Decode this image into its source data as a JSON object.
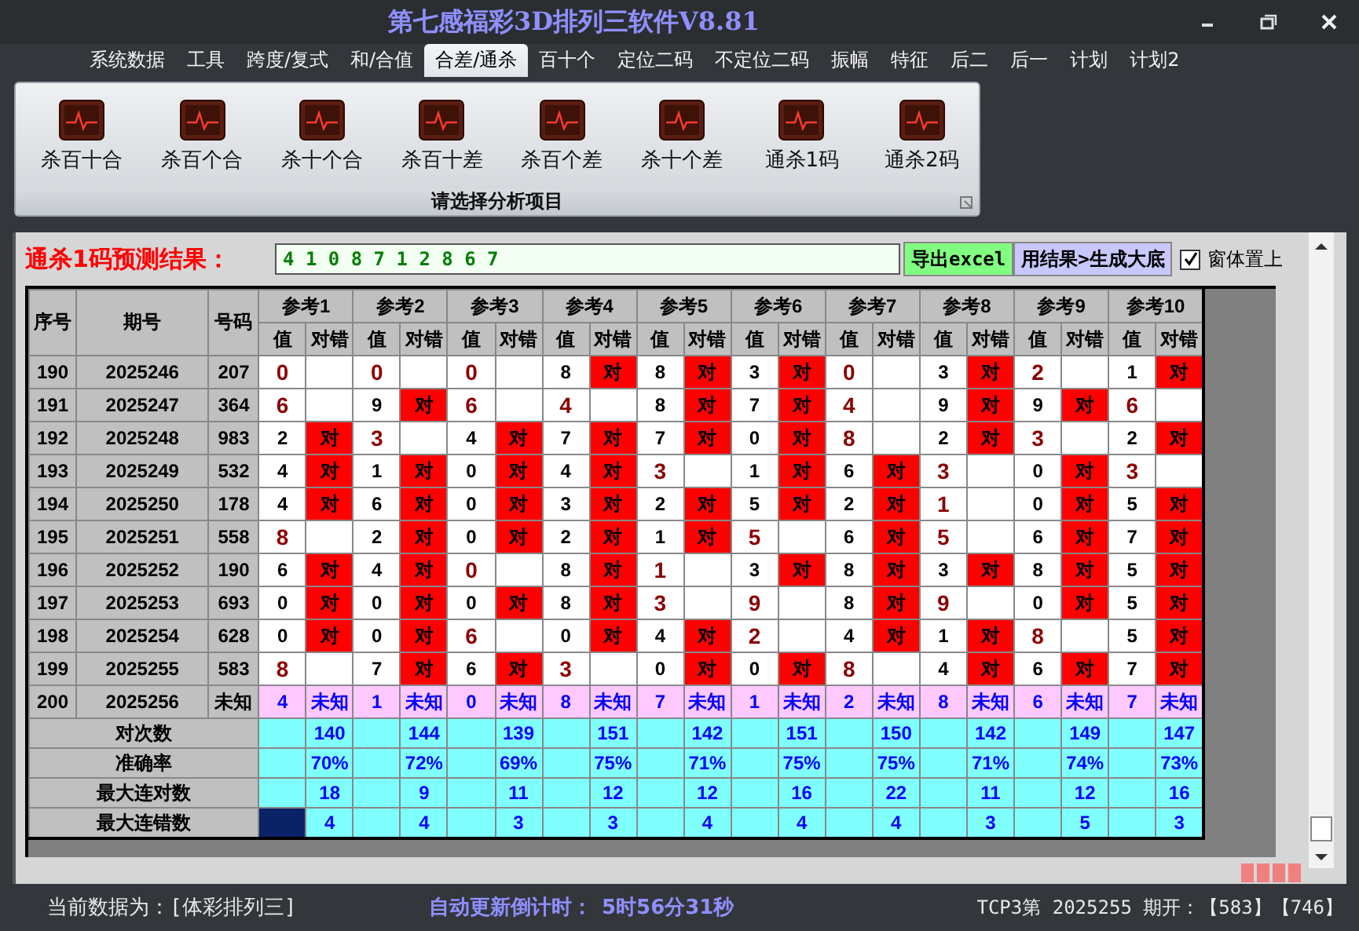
{
  "window": {
    "title": "第七感福彩3D排列三软件V8.81"
  },
  "menu": [
    {
      "label": "系统数据",
      "selected": false
    },
    {
      "label": "工具",
      "selected": false
    },
    {
      "label": "跨度/复式",
      "selected": false
    },
    {
      "label": "和/合值",
      "selected": false
    },
    {
      "label": "合差/通杀",
      "selected": true
    },
    {
      "label": "百十个",
      "selected": false
    },
    {
      "label": "定位二码",
      "selected": false
    },
    {
      "label": "不定位二码",
      "selected": false
    },
    {
      "label": "振幅",
      "selected": false
    },
    {
      "label": "特征",
      "selected": false
    },
    {
      "label": "后二",
      "selected": false
    },
    {
      "label": "后一",
      "selected": false
    },
    {
      "label": "计划",
      "selected": false
    },
    {
      "label": "计划2",
      "selected": false
    }
  ],
  "ribbon": {
    "items": [
      "杀百十合",
      "杀百个合",
      "杀十个合",
      "杀百十差",
      "杀百个差",
      "杀十个差",
      "通杀1码",
      "通杀2码"
    ],
    "caption": "请选择分析项目"
  },
  "prediction": {
    "label": "通杀1码预测结果：",
    "value": "4 1 0 8 7 1 2 8 6 7"
  },
  "buttons": [
    {
      "label": "导出excel",
      "kind": "export"
    },
    {
      "label": "用结果>生成大底",
      "kind": "generate"
    }
  ],
  "always_on_top": {
    "label": "窗体置上",
    "checked": true
  },
  "table": {
    "columns": [
      "序号",
      "期号",
      "号码"
    ],
    "groups": [
      {
        "label": "参考1",
        "subcolumns": [
          "值",
          "对错"
        ]
      },
      {
        "label": "参考2",
        "subcolumns": [
          "值",
          "对错"
        ]
      },
      {
        "label": "参考3",
        "subcolumns": [
          "值",
          "对错"
        ]
      },
      {
        "label": "参考4",
        "subcolumns": [
          "值",
          "对错"
        ]
      },
      {
        "label": "参考5",
        "subcolumns": [
          "值",
          "对错"
        ]
      },
      {
        "label": "参考6",
        "subcolumns": [
          "值",
          "对错"
        ]
      },
      {
        "label": "参考7",
        "subcolumns": [
          "值",
          "对错"
        ]
      },
      {
        "label": "参考8",
        "subcolumns": [
          "值",
          "对错"
        ]
      },
      {
        "label": "参考9",
        "subcolumns": [
          "值",
          "对错"
        ]
      },
      {
        "label": "参考10",
        "subcolumns": [
          "值",
          "对错"
        ]
      }
    ],
    "rows": [
      {
        "kind": "history",
        "seq": "190",
        "period": "2025246",
        "number": "207",
        "cells": [
          {
            "value": "0"
          },
          {
            "value": "0"
          },
          {
            "value": "0"
          },
          {
            "value": "8",
            "result": "对"
          },
          {
            "value": "8",
            "result": "对"
          },
          {
            "value": "3",
            "result": "对"
          },
          {
            "value": "0"
          },
          {
            "value": "3",
            "result": "对"
          },
          {
            "value": "2"
          },
          {
            "value": "1",
            "result": "对"
          }
        ]
      },
      {
        "kind": "history",
        "seq": "191",
        "period": "2025247",
        "number": "364",
        "cells": [
          {
            "value": "6"
          },
          {
            "value": "9",
            "result": "对"
          },
          {
            "value": "6"
          },
          {
            "value": "4"
          },
          {
            "value": "8",
            "result": "对"
          },
          {
            "value": "7",
            "result": "对"
          },
          {
            "value": "4"
          },
          {
            "value": "9",
            "result": "对"
          },
          {
            "value": "9",
            "result": "对"
          },
          {
            "value": "6"
          }
        ]
      },
      {
        "kind": "history",
        "seq": "192",
        "period": "2025248",
        "number": "983",
        "cells": [
          {
            "value": "2",
            "result": "对"
          },
          {
            "value": "3"
          },
          {
            "value": "4",
            "result": "对"
          },
          {
            "value": "7",
            "result": "对"
          },
          {
            "value": "7",
            "result": "对"
          },
          {
            "value": "0",
            "result": "对"
          },
          {
            "value": "8"
          },
          {
            "value": "2",
            "result": "对"
          },
          {
            "value": "3"
          },
          {
            "value": "2",
            "result": "对"
          }
        ]
      },
      {
        "kind": "history",
        "seq": "193",
        "period": "2025249",
        "number": "532",
        "cells": [
          {
            "value": "4",
            "result": "对"
          },
          {
            "value": "1",
            "result": "对"
          },
          {
            "value": "0",
            "result": "对"
          },
          {
            "value": "4",
            "result": "对"
          },
          {
            "value": "3"
          },
          {
            "value": "1",
            "result": "对"
          },
          {
            "value": "6",
            "result": "对"
          },
          {
            "value": "3"
          },
          {
            "value": "0",
            "result": "对"
          },
          {
            "value": "3"
          }
        ]
      },
      {
        "kind": "history",
        "seq": "194",
        "period": "2025250",
        "number": "178",
        "cells": [
          {
            "value": "4",
            "result": "对"
          },
          {
            "value": "6",
            "result": "对"
          },
          {
            "value": "0",
            "result": "对"
          },
          {
            "value": "3",
            "result": "对"
          },
          {
            "value": "2",
            "result": "对"
          },
          {
            "value": "5",
            "result": "对"
          },
          {
            "value": "2",
            "result": "对"
          },
          {
            "value": "1"
          },
          {
            "value": "0",
            "result": "对"
          },
          {
            "value": "5",
            "result": "对"
          }
        ]
      },
      {
        "kind": "history",
        "seq": "195",
        "period": "2025251",
        "number": "558",
        "cells": [
          {
            "value": "8"
          },
          {
            "value": "2",
            "result": "对"
          },
          {
            "value": "0",
            "result": "对"
          },
          {
            "value": "2",
            "result": "对"
          },
          {
            "value": "1",
            "result": "对"
          },
          {
            "value": "5"
          },
          {
            "value": "6",
            "result": "对"
          },
          {
            "value": "5"
          },
          {
            "value": "6",
            "result": "对"
          },
          {
            "value": "7",
            "result": "对"
          }
        ]
      },
      {
        "kind": "history",
        "seq": "196",
        "period": "2025252",
        "number": "190",
        "cells": [
          {
            "value": "6",
            "result": "对"
          },
          {
            "value": "4",
            "result": "对"
          },
          {
            "value": "0"
          },
          {
            "value": "8",
            "result": "对"
          },
          {
            "value": "1"
          },
          {
            "value": "3",
            "result": "对"
          },
          {
            "value": "8",
            "result": "对"
          },
          {
            "value": "3",
            "result": "对"
          },
          {
            "value": "8",
            "result": "对"
          },
          {
            "value": "5",
            "result": "对"
          }
        ]
      },
      {
        "kind": "history",
        "seq": "197",
        "period": "2025253",
        "number": "693",
        "cells": [
          {
            "value": "0",
            "result": "对"
          },
          {
            "value": "0",
            "result": "对"
          },
          {
            "value": "0",
            "result": "对"
          },
          {
            "value": "8",
            "result": "对"
          },
          {
            "value": "3"
          },
          {
            "value": "9"
          },
          {
            "value": "8",
            "result": "对"
          },
          {
            "value": "9"
          },
          {
            "value": "0",
            "result": "对"
          },
          {
            "value": "5",
            "result": "对"
          }
        ]
      },
      {
        "kind": "history",
        "seq": "198",
        "period": "2025254",
        "number": "628",
        "cells": [
          {
            "value": "0",
            "result": "对"
          },
          {
            "value": "0",
            "result": "对"
          },
          {
            "value": "6"
          },
          {
            "value": "0",
            "result": "对"
          },
          {
            "value": "4",
            "result": "对"
          },
          {
            "value": "2"
          },
          {
            "value": "4",
            "result": "对"
          },
          {
            "value": "1",
            "result": "对"
          },
          {
            "value": "8"
          },
          {
            "value": "5",
            "result": "对"
          }
        ]
      },
      {
        "kind": "history",
        "seq": "199",
        "period": "2025255",
        "number": "583",
        "cells": [
          {
            "value": "8"
          },
          {
            "value": "7",
            "result": "对"
          },
          {
            "value": "6",
            "result": "对"
          },
          {
            "value": "3"
          },
          {
            "value": "0",
            "result": "对"
          },
          {
            "value": "0",
            "result": "对"
          },
          {
            "value": "8"
          },
          {
            "value": "4",
            "result": "对"
          },
          {
            "value": "6",
            "result": "对"
          },
          {
            "value": "7",
            "result": "对"
          }
        ]
      },
      {
        "kind": "pending",
        "seq": "200",
        "period": "2025256",
        "number": "未知",
        "cells": [
          {
            "value": "4",
            "result": "未知"
          },
          {
            "value": "1",
            "result": "未知"
          },
          {
            "value": "0",
            "result": "未知"
          },
          {
            "value": "8",
            "result": "未知"
          },
          {
            "value": "7",
            "result": "未知"
          },
          {
            "value": "1",
            "result": "未知"
          },
          {
            "value": "2",
            "result": "未知"
          },
          {
            "value": "8",
            "result": "未知"
          },
          {
            "value": "6",
            "result": "未知"
          },
          {
            "value": "7",
            "result": "未知"
          }
        ]
      }
    ],
    "stats": [
      {
        "label": "对次数",
        "selected": false,
        "values": [
          "140",
          "144",
          "139",
          "151",
          "142",
          "151",
          "150",
          "142",
          "149",
          "147"
        ]
      },
      {
        "label": "准确率",
        "selected": false,
        "values": [
          "70%",
          "72%",
          "69%",
          "75%",
          "71%",
          "75%",
          "75%",
          "71%",
          "74%",
          "73%"
        ]
      },
      {
        "label": "最大连对数",
        "selected": false,
        "values": [
          "18",
          "9",
          "11",
          "12",
          "12",
          "16",
          "22",
          "11",
          "12",
          "16"
        ]
      },
      {
        "label": "最大连错数",
        "selected": true,
        "values": [
          "4",
          "4",
          "3",
          "3",
          "4",
          "4",
          "4",
          "3",
          "5",
          "3"
        ]
      }
    ]
  },
  "status_bar": {
    "data_source": "当前数据为：[体彩排列三]",
    "countdown_label": "自动更新倒计时：",
    "countdown": "5时56分31秒",
    "draw_info": "TCP3第 2025255 期开：【583】【746】"
  }
}
